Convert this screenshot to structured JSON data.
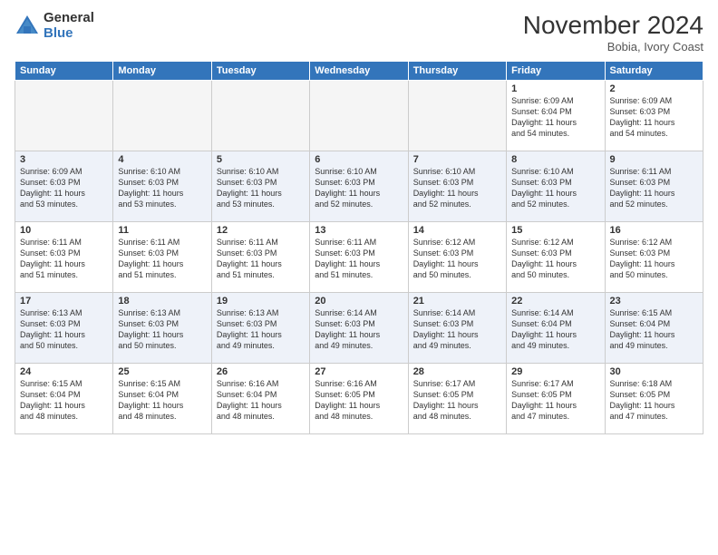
{
  "header": {
    "logo_general": "General",
    "logo_blue": "Blue",
    "month": "November 2024",
    "location": "Bobia, Ivory Coast"
  },
  "days_of_week": [
    "Sunday",
    "Monday",
    "Tuesday",
    "Wednesday",
    "Thursday",
    "Friday",
    "Saturday"
  ],
  "weeks": [
    [
      {
        "day": "",
        "info": ""
      },
      {
        "day": "",
        "info": ""
      },
      {
        "day": "",
        "info": ""
      },
      {
        "day": "",
        "info": ""
      },
      {
        "day": "",
        "info": ""
      },
      {
        "day": "1",
        "info": "Sunrise: 6:09 AM\nSunset: 6:04 PM\nDaylight: 11 hours\nand 54 minutes."
      },
      {
        "day": "2",
        "info": "Sunrise: 6:09 AM\nSunset: 6:03 PM\nDaylight: 11 hours\nand 54 minutes."
      }
    ],
    [
      {
        "day": "3",
        "info": "Sunrise: 6:09 AM\nSunset: 6:03 PM\nDaylight: 11 hours\nand 53 minutes."
      },
      {
        "day": "4",
        "info": "Sunrise: 6:10 AM\nSunset: 6:03 PM\nDaylight: 11 hours\nand 53 minutes."
      },
      {
        "day": "5",
        "info": "Sunrise: 6:10 AM\nSunset: 6:03 PM\nDaylight: 11 hours\nand 53 minutes."
      },
      {
        "day": "6",
        "info": "Sunrise: 6:10 AM\nSunset: 6:03 PM\nDaylight: 11 hours\nand 52 minutes."
      },
      {
        "day": "7",
        "info": "Sunrise: 6:10 AM\nSunset: 6:03 PM\nDaylight: 11 hours\nand 52 minutes."
      },
      {
        "day": "8",
        "info": "Sunrise: 6:10 AM\nSunset: 6:03 PM\nDaylight: 11 hours\nand 52 minutes."
      },
      {
        "day": "9",
        "info": "Sunrise: 6:11 AM\nSunset: 6:03 PM\nDaylight: 11 hours\nand 52 minutes."
      }
    ],
    [
      {
        "day": "10",
        "info": "Sunrise: 6:11 AM\nSunset: 6:03 PM\nDaylight: 11 hours\nand 51 minutes."
      },
      {
        "day": "11",
        "info": "Sunrise: 6:11 AM\nSunset: 6:03 PM\nDaylight: 11 hours\nand 51 minutes."
      },
      {
        "day": "12",
        "info": "Sunrise: 6:11 AM\nSunset: 6:03 PM\nDaylight: 11 hours\nand 51 minutes."
      },
      {
        "day": "13",
        "info": "Sunrise: 6:11 AM\nSunset: 6:03 PM\nDaylight: 11 hours\nand 51 minutes."
      },
      {
        "day": "14",
        "info": "Sunrise: 6:12 AM\nSunset: 6:03 PM\nDaylight: 11 hours\nand 50 minutes."
      },
      {
        "day": "15",
        "info": "Sunrise: 6:12 AM\nSunset: 6:03 PM\nDaylight: 11 hours\nand 50 minutes."
      },
      {
        "day": "16",
        "info": "Sunrise: 6:12 AM\nSunset: 6:03 PM\nDaylight: 11 hours\nand 50 minutes."
      }
    ],
    [
      {
        "day": "17",
        "info": "Sunrise: 6:13 AM\nSunset: 6:03 PM\nDaylight: 11 hours\nand 50 minutes."
      },
      {
        "day": "18",
        "info": "Sunrise: 6:13 AM\nSunset: 6:03 PM\nDaylight: 11 hours\nand 50 minutes."
      },
      {
        "day": "19",
        "info": "Sunrise: 6:13 AM\nSunset: 6:03 PM\nDaylight: 11 hours\nand 49 minutes."
      },
      {
        "day": "20",
        "info": "Sunrise: 6:14 AM\nSunset: 6:03 PM\nDaylight: 11 hours\nand 49 minutes."
      },
      {
        "day": "21",
        "info": "Sunrise: 6:14 AM\nSunset: 6:03 PM\nDaylight: 11 hours\nand 49 minutes."
      },
      {
        "day": "22",
        "info": "Sunrise: 6:14 AM\nSunset: 6:04 PM\nDaylight: 11 hours\nand 49 minutes."
      },
      {
        "day": "23",
        "info": "Sunrise: 6:15 AM\nSunset: 6:04 PM\nDaylight: 11 hours\nand 49 minutes."
      }
    ],
    [
      {
        "day": "24",
        "info": "Sunrise: 6:15 AM\nSunset: 6:04 PM\nDaylight: 11 hours\nand 48 minutes."
      },
      {
        "day": "25",
        "info": "Sunrise: 6:15 AM\nSunset: 6:04 PM\nDaylight: 11 hours\nand 48 minutes."
      },
      {
        "day": "26",
        "info": "Sunrise: 6:16 AM\nSunset: 6:04 PM\nDaylight: 11 hours\nand 48 minutes."
      },
      {
        "day": "27",
        "info": "Sunrise: 6:16 AM\nSunset: 6:05 PM\nDaylight: 11 hours\nand 48 minutes."
      },
      {
        "day": "28",
        "info": "Sunrise: 6:17 AM\nSunset: 6:05 PM\nDaylight: 11 hours\nand 48 minutes."
      },
      {
        "day": "29",
        "info": "Sunrise: 6:17 AM\nSunset: 6:05 PM\nDaylight: 11 hours\nand 47 minutes."
      },
      {
        "day": "30",
        "info": "Sunrise: 6:18 AM\nSunset: 6:05 PM\nDaylight: 11 hours\nand 47 minutes."
      }
    ]
  ]
}
